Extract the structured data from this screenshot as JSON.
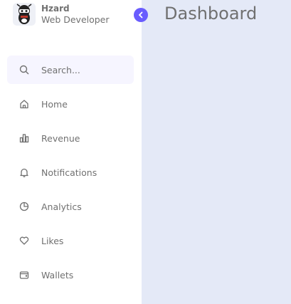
{
  "profile": {
    "name": "Hzard",
    "role": "Web Developer"
  },
  "search": {
    "placeholder": "Search..."
  },
  "nav": {
    "items": [
      {
        "label": "Home",
        "icon": "home-icon"
      },
      {
        "label": "Revenue",
        "icon": "bar-chart-icon"
      },
      {
        "label": "Notifications",
        "icon": "bell-icon"
      },
      {
        "label": "Analytics",
        "icon": "pie-chart-icon"
      },
      {
        "label": "Likes",
        "icon": "heart-icon"
      },
      {
        "label": "Wallets",
        "icon": "wallet-icon"
      }
    ]
  },
  "main": {
    "title": "Dashboard"
  },
  "colors": {
    "accent": "#695cfe",
    "text": "#707070",
    "sidebar_bg": "#ffffff",
    "main_bg": "#e4e9f7",
    "search_bg": "#f6f5ff"
  }
}
